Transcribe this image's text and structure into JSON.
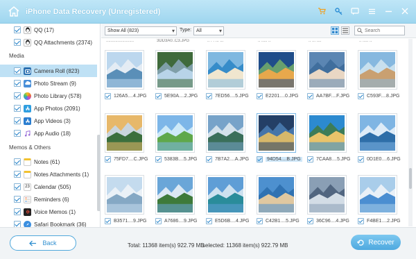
{
  "app": {
    "title": "iPhone Data Recovery (Unregistered)"
  },
  "titlebar_icons": [
    "cart-icon",
    "key-icon",
    "chat-icon",
    "menu-icon",
    "minimize-icon",
    "close-icon"
  ],
  "sidebar": {
    "top_items": [
      {
        "label": "QQ (17)"
      },
      {
        "label": "QQ Attachments (2374)"
      }
    ],
    "media_header": "Media",
    "media_items": [
      {
        "label": "Camera Roll (823)",
        "selected": true,
        "color": "#2a6fb0"
      },
      {
        "label": "Photo Stream (9)",
        "color": "#4a90d9"
      },
      {
        "label": "Photo Library (578)",
        "color": "#e86f3a"
      },
      {
        "label": "App Photos (2091)",
        "color": "#2f9ee0"
      },
      {
        "label": "App Videos (3)",
        "color": "#2b7ed0"
      },
      {
        "label": "App Audio (18)",
        "color": "#9a6fd8"
      }
    ],
    "memos_header": "Memos & Others",
    "memos_items": [
      {
        "label": "Notes (61)",
        "color": "#f2c230"
      },
      {
        "label": "Notes Attachments (1)",
        "color": "#f2c230"
      },
      {
        "label": "Calendar (505)",
        "color": "#ffffff",
        "text": "23"
      },
      {
        "label": "Reminders (6)",
        "color": "#ffffff"
      },
      {
        "label": "Voice Memos (1)",
        "color": "#222222"
      },
      {
        "label": "Safari Bookmark (36)",
        "color": "#3b8fe0"
      }
    ]
  },
  "toolbar": {
    "filter_value": "Show All (823)",
    "type_label": "Type:",
    "type_value": "All",
    "search_placeholder": "Search"
  },
  "partial_row": [
    "........................",
    "3DD3A0..C3.JPG",
    ".. . . ... ...",
    ".. ..... ..",
    ".. ... ....",
    ".. ..... .."
  ],
  "photos": [
    {
      "name": "126A5....4.JPG",
      "palette": [
        "#bcd7ee",
        "#5a8fb8",
        "#e8eef4"
      ]
    },
    {
      "name": "5E90A....2.JPG",
      "palette": [
        "#3f6a3b",
        "#b8d4e8",
        "#86a5b5"
      ]
    },
    {
      "name": "7ED56....5.JPG",
      "palette": [
        "#7fb8e0",
        "#f0e6cf",
        "#2f87c7"
      ]
    },
    {
      "name": "E2201....0.JPG",
      "palette": [
        "#1f4d8a",
        "#e7a84c",
        "#6fa86a"
      ]
    },
    {
      "name": "AA7BF....F.JPG",
      "palette": [
        "#5b86b3",
        "#e9d7c4",
        "#3d6b9a"
      ]
    },
    {
      "name": "C593F....8.JPG",
      "palette": [
        "#86b8df",
        "#c9a071",
        "#cfe4f0"
      ]
    },
    {
      "name": "75FD7....C.JPG",
      "palette": [
        "#e7b86a",
        "#3b6f3d",
        "#c7d8ea"
      ]
    },
    {
      "name": "5383B....5.JPG",
      "palette": [
        "#7db6e8",
        "#5fa84a",
        "#d6eef9"
      ]
    },
    {
      "name": "7B7A2....A.JPG",
      "palette": [
        "#77a3c9",
        "#3a6f5a",
        "#dde8ee"
      ]
    },
    {
      "name": "94D54....B.JPG",
      "palette": [
        "#243f66",
        "#d7b86a",
        "#4a7bb0"
      ],
      "selected": true
    },
    {
      "name": "7CAA8....5.JPG",
      "palette": [
        "#2c8ad0",
        "#e9c46a",
        "#3f7a4a"
      ]
    },
    {
      "name": "0D1E0....6.JPG",
      "palette": [
        "#7fb5e3",
        "#2e6ea8",
        "#e8f1f8"
      ]
    },
    {
      "name": "B3571....9.JPG",
      "palette": [
        "#c4dbee",
        "#85a8c4",
        "#eef3f7"
      ]
    },
    {
      "name": "A7686....9.JPG",
      "palette": [
        "#6aa6d8",
        "#3e7a3a",
        "#e8f0f6"
      ]
    },
    {
      "name": "E5D6B....4.JPG",
      "palette": [
        "#5f9ed6",
        "#2a8c9a",
        "#d9e8f2"
      ]
    },
    {
      "name": "C42B1....5.JPG",
      "palette": [
        "#4d90cf",
        "#e0c8a0",
        "#2d6fae"
      ]
    },
    {
      "name": "36C96....4.JPG",
      "palette": [
        "#8a9fb5",
        "#d3dde6",
        "#4a5f7a"
      ]
    },
    {
      "name": "F4BE1....2.JPG",
      "palette": [
        "#a9cdea",
        "#4b8ed1",
        "#f0f4f8"
      ]
    }
  ],
  "footer": {
    "back_label": "Back",
    "total_text": "Total: 11368 item(s) 922.79 MB",
    "selected_text": "selected: 11368 item(s) 922.79 MB",
    "recover_label": "Recover"
  }
}
